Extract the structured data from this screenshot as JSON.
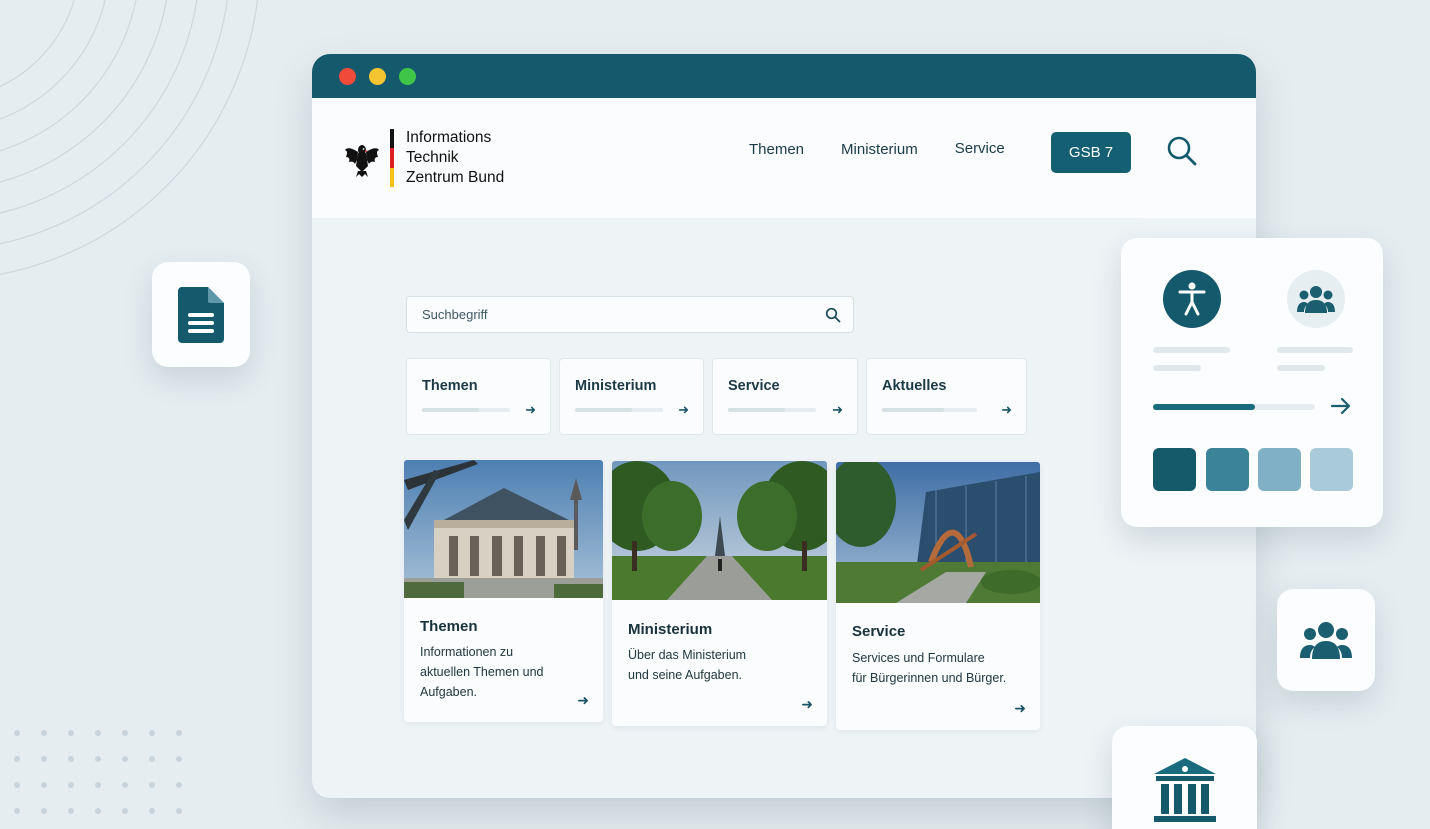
{
  "window": {
    "header": {
      "logo_lines": [
        "Informations",
        "Technik",
        "Zentrum Bund"
      ],
      "nav": [
        "Themen",
        "Ministerium",
        "Service"
      ],
      "cta_label": "GSB 7"
    },
    "search": {
      "placeholder": "Suchbegriff"
    },
    "quick_cards": [
      {
        "label": "Themen"
      },
      {
        "label": "Ministerium"
      },
      {
        "label": "Service"
      },
      {
        "label": "Aktuelles"
      }
    ],
    "content_cards": [
      {
        "title": "Themen",
        "description": "Informationen zu\naktuellen Themen und\nAufgaben.",
        "image": "building-photo"
      },
      {
        "title": "Ministerium",
        "description": "Über das Ministerium\nund seine Aufgaben.",
        "image": "tree-avenue-photo"
      },
      {
        "title": "Service",
        "description": "Services und Formulare\nfür Bürgerinnen und Bürger.",
        "image": "modern-campus-photo"
      }
    ]
  },
  "widgets": {
    "panel": {
      "progress": 0.63,
      "swatches": [
        "#155a6a",
        "#3a8399",
        "#7fb0c6",
        "#a8cad9"
      ]
    },
    "icons": [
      "document-icon",
      "accessibility-icon",
      "group-icon",
      "people-icon",
      "institution-icon"
    ]
  },
  "colors": {
    "primary": "#145a6c",
    "titlebar": "#145a6c",
    "background": "#e6edf1"
  }
}
